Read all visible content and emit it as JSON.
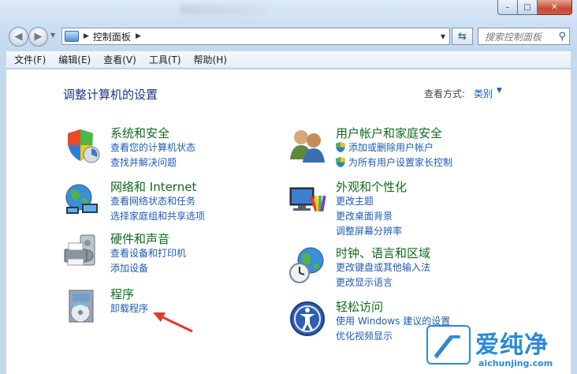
{
  "window": {
    "caption": {
      "minimize": "–",
      "maximize": "□",
      "close": "✕"
    }
  },
  "address_bar": {
    "path": "控制面板",
    "search_placeholder": "搜索控制面板"
  },
  "menu": [
    "文件(F)",
    "编辑(E)",
    "查看(V)",
    "工具(T)",
    "帮助(H)"
  ],
  "content": {
    "title": "调整计算机的设置",
    "view_by_label": "查看方式:",
    "view_by_value": "类别"
  },
  "categories_left": [
    {
      "title": "系统和安全",
      "icon": "shield-icon",
      "links": [
        "查看您的计算机状态",
        "查找并解决问题"
      ]
    },
    {
      "title": "网络和 Internet",
      "icon": "network-globe-icon",
      "links": [
        "查看网络状态和任务",
        "选择家庭组和共享选项"
      ]
    },
    {
      "title": "硬件和声音",
      "icon": "printer-icon",
      "links": [
        "查看设备和打印机",
        "添加设备"
      ]
    },
    {
      "title": "程序",
      "icon": "program-disc-icon",
      "links": [
        "卸载程序"
      ]
    }
  ],
  "categories_right": [
    {
      "title": "用户帐户和家庭安全",
      "icon": "users-icon",
      "links": [
        "添加或删除用户帐户",
        "为所有用户设置家长控制"
      ]
    },
    {
      "title": "外观和个性化",
      "icon": "monitor-palette-icon",
      "links": [
        "更改主题",
        "更改桌面背景",
        "调整屏幕分辨率"
      ]
    },
    {
      "title": "时钟、语言和区域",
      "icon": "clock-globe-icon",
      "links": [
        "更改键盘或其他输入法",
        "更改显示语言"
      ]
    },
    {
      "title": "轻松访问",
      "icon": "ease-of-access-icon",
      "links": [
        "使用 Windows 建议的设置",
        "优化视频显示"
      ]
    }
  ],
  "watermark": {
    "brand": "爱纯净",
    "url": "aichunjing.com"
  },
  "colors": {
    "title_blue": "#1e3287",
    "category_green": "#0e6b1e",
    "link_blue": "#1d5bb8",
    "arrow_red": "#e23b2a"
  }
}
